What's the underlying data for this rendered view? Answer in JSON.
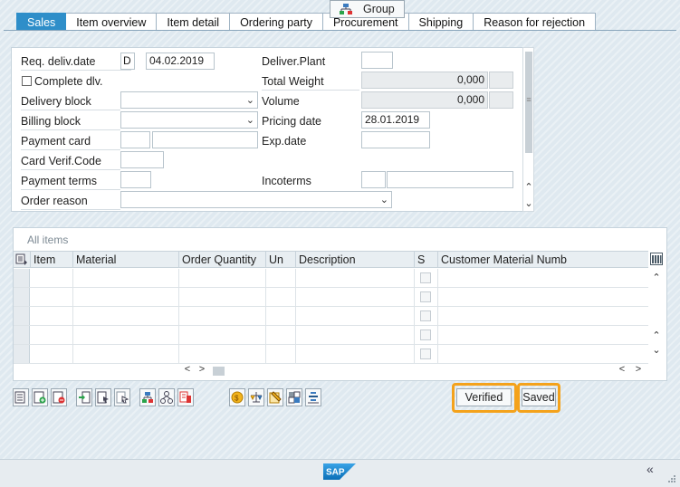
{
  "tabs": [
    {
      "label": "Sales"
    },
    {
      "label": "Item overview"
    },
    {
      "label": "Item detail"
    },
    {
      "label": "Ordering party"
    },
    {
      "label": "Procurement"
    },
    {
      "label": "Shipping"
    },
    {
      "label": "Reason for rejection"
    }
  ],
  "form": {
    "req_deliv_date": {
      "label": "Req. deliv.date",
      "type": "D",
      "value": "04.02.2019"
    },
    "deliver_plant": {
      "label": "Deliver.Plant",
      "value": ""
    },
    "complete_dlv": {
      "label": "Complete dlv.",
      "checked": false
    },
    "total_weight": {
      "label": "Total Weight",
      "value": "0,000",
      "unit": ""
    },
    "delivery_block": {
      "label": "Delivery block",
      "value": ""
    },
    "volume": {
      "label": "Volume",
      "value": "0,000",
      "unit": ""
    },
    "billing_block": {
      "label": "Billing block",
      "value": ""
    },
    "pricing_date": {
      "label": "Pricing date",
      "value": "28.01.2019"
    },
    "payment_card": {
      "label": "Payment card",
      "value": "",
      "value2": ""
    },
    "exp_date": {
      "label": "Exp.date",
      "value": ""
    },
    "card_verif_code": {
      "label": "Card Verif.Code",
      "value": ""
    },
    "payment_terms": {
      "label": "Payment terms",
      "value": ""
    },
    "incoterms": {
      "label": "Incoterms",
      "value": "",
      "value2": ""
    },
    "order_reason": {
      "label": "Order reason",
      "value": ""
    }
  },
  "items": {
    "title": "All items",
    "columns": [
      "Item",
      "Material",
      "Order Quantity",
      "Un",
      "Description",
      "S",
      "Customer Material Numb"
    ],
    "rows": [
      {
        "item": "",
        "material": "",
        "qty": "",
        "unit": "",
        "description": "",
        "s": false,
        "cust_mat": ""
      },
      {
        "item": "",
        "material": "",
        "qty": "",
        "unit": "",
        "description": "",
        "s": false,
        "cust_mat": ""
      },
      {
        "item": "",
        "material": "",
        "qty": "",
        "unit": "",
        "description": "",
        "s": false,
        "cust_mat": ""
      },
      {
        "item": "",
        "material": "",
        "qty": "",
        "unit": "",
        "description": "",
        "s": false,
        "cust_mat": ""
      },
      {
        "item": "",
        "material": "",
        "qty": "",
        "unit": "",
        "description": "",
        "s": false,
        "cust_mat": ""
      }
    ]
  },
  "toolbar": {
    "group_label": "Group",
    "verified_label": "Verified",
    "saved_label": "Saved"
  },
  "footer": {
    "logo_text": "SAP",
    "collapse_glyph": "«"
  },
  "colors": {
    "tab_active": "#2e8ec9",
    "highlight": "#f4a21b"
  }
}
